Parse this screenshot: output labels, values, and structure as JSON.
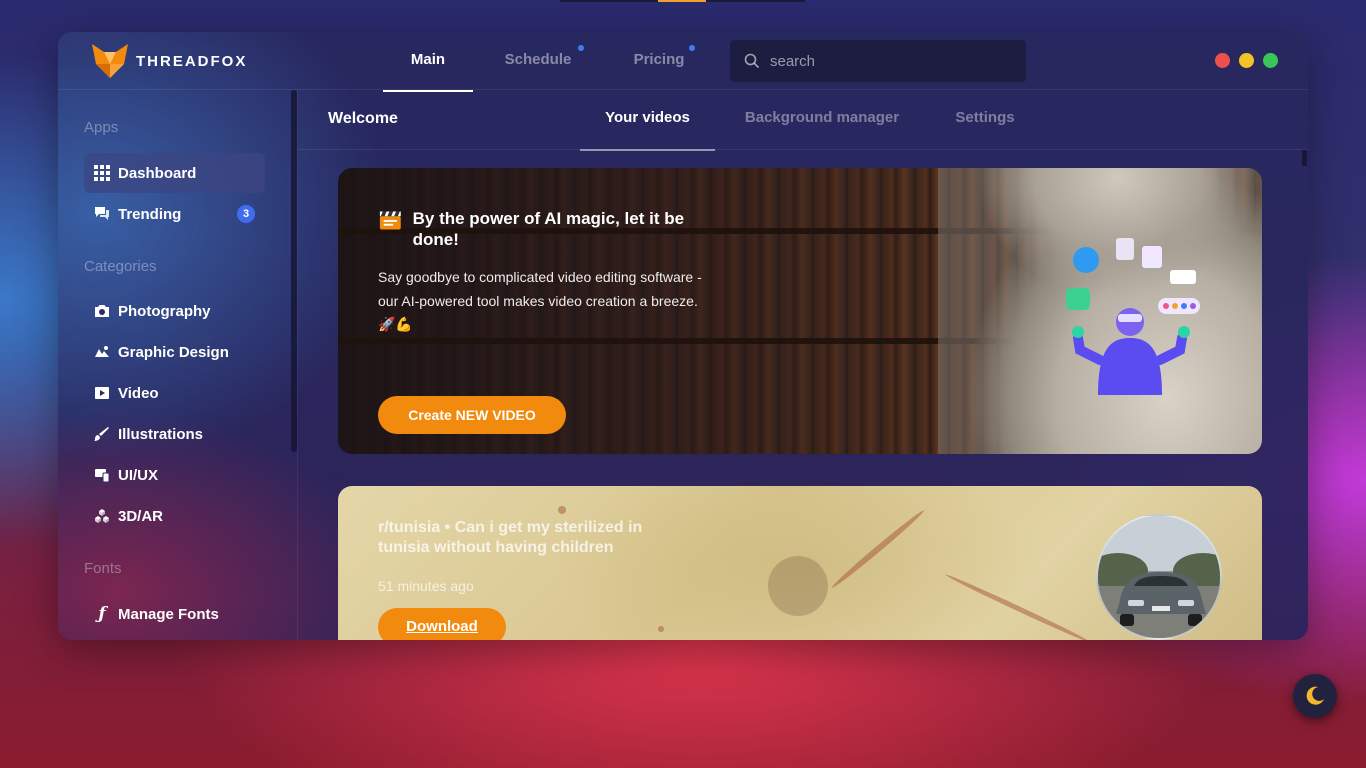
{
  "app": {
    "name": "THREADFOX",
    "brand_color": "#f28a0e",
    "window_controls": [
      {
        "name": "close",
        "color": "#ee5050"
      },
      {
        "name": "minimize",
        "color": "#f2c428"
      },
      {
        "name": "maximize",
        "color": "#38c65a"
      }
    ]
  },
  "header": {
    "tabs": [
      {
        "label": "Main",
        "active": true,
        "dot": false
      },
      {
        "label": "Schedule",
        "active": false,
        "dot": true
      },
      {
        "label": "Pricing",
        "active": false,
        "dot": true
      }
    ],
    "search": {
      "placeholder": "search",
      "value": ""
    }
  },
  "sidebar": {
    "apps_title": "Apps",
    "apps": [
      {
        "label": "Dashboard",
        "icon": "grid-icon",
        "active": true
      },
      {
        "label": "Trending",
        "icon": "chat-icon",
        "badge": "3"
      }
    ],
    "categories_title": "Categories",
    "categories": [
      {
        "label": "Photography",
        "icon": "camera-icon"
      },
      {
        "label": "Graphic Design",
        "icon": "design-icon"
      },
      {
        "label": "Video",
        "icon": "video-icon"
      },
      {
        "label": "Illustrations",
        "icon": "brush-icon"
      },
      {
        "label": "UI/UX",
        "icon": "devices-icon"
      },
      {
        "label": "3D/AR",
        "icon": "cubes-icon"
      }
    ],
    "fonts_title": "Fonts",
    "fonts": [
      {
        "label": "Manage Fonts",
        "icon": "font-icon"
      }
    ]
  },
  "subnav": {
    "welcome": "Welcome",
    "tabs": [
      {
        "label": "Your videos",
        "active": true
      },
      {
        "label": "Background manager",
        "active": false
      },
      {
        "label": "Settings",
        "active": false
      }
    ]
  },
  "hero_card": {
    "icon": "clapperboard-icon",
    "title": "By the power of AI magic, let it be done!",
    "description": "Say goodbye to complicated video editing software - our AI-powered tool makes video creation a breeze. 🚀💪",
    "button": "Create NEW VIDEO"
  },
  "post_card": {
    "title": "r/tunisia • Can i get my sterilized in tunisia without having children",
    "time": "51 minutes ago",
    "button": "Download"
  },
  "theme_toggle": {
    "icon": "moon-icon"
  }
}
